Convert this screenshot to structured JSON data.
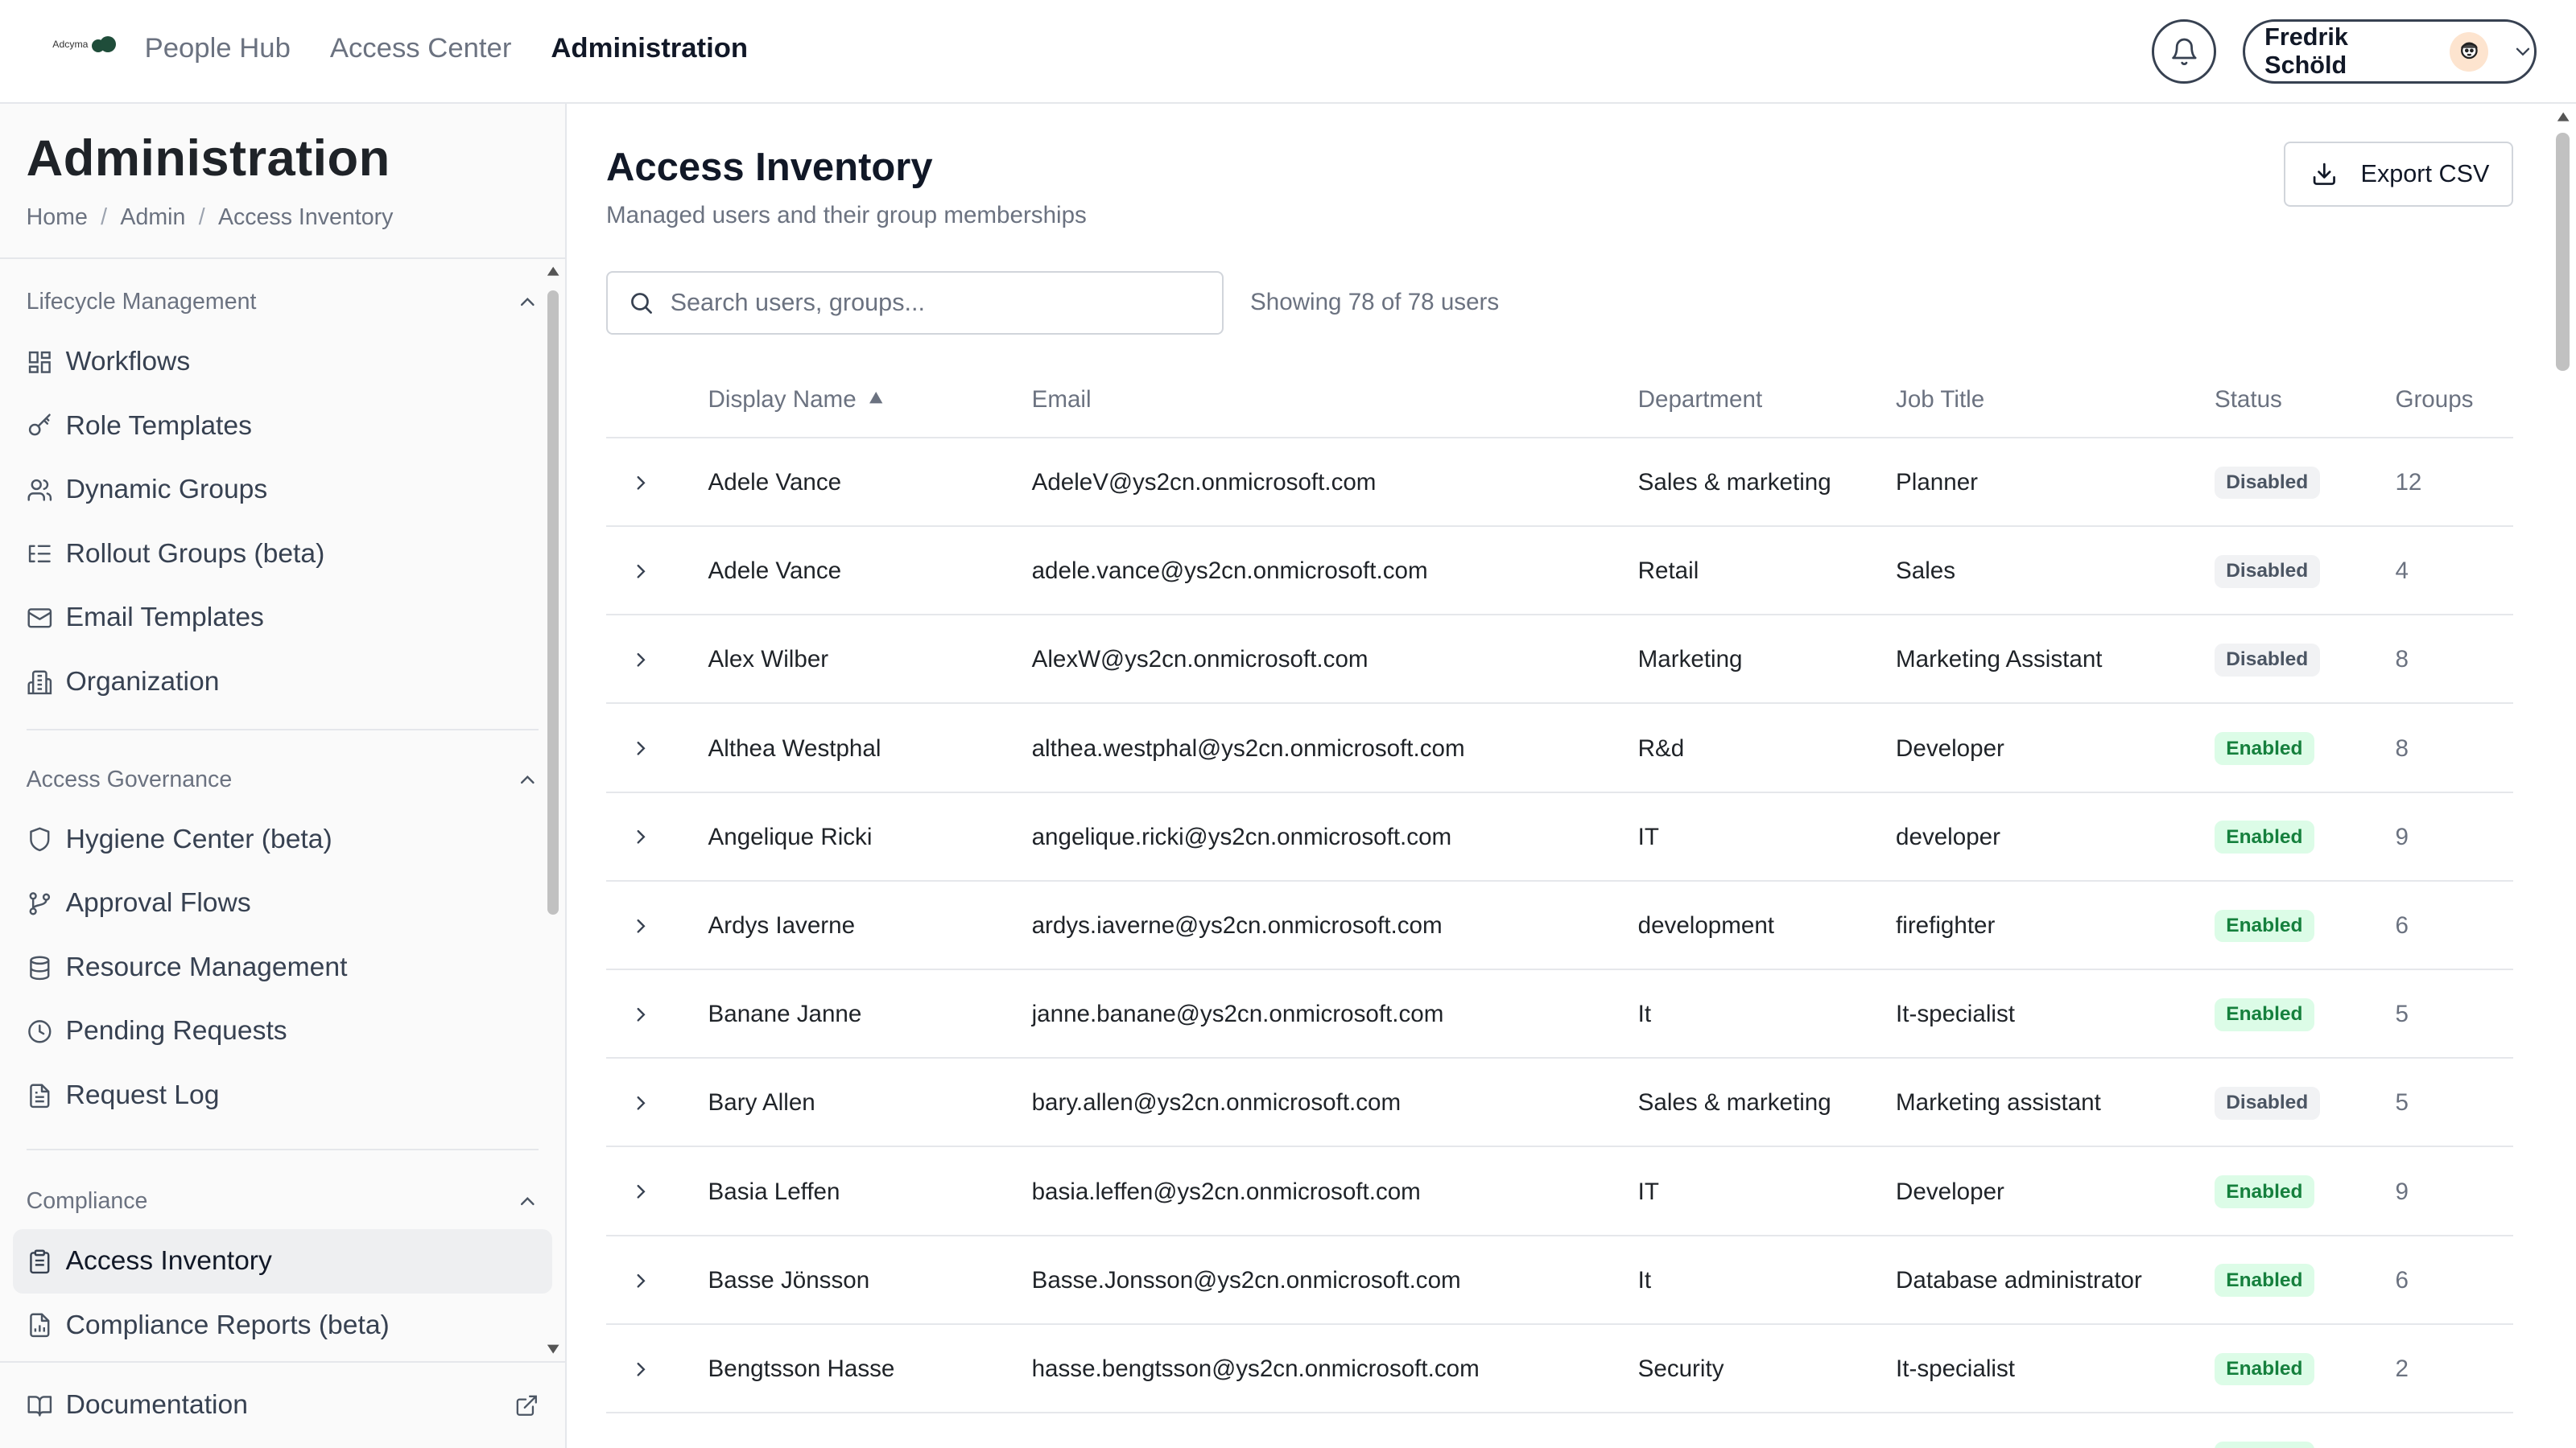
{
  "brand": {
    "logo_text": "Adcyma"
  },
  "topnav": [
    {
      "label": "People Hub",
      "active": false
    },
    {
      "label": "Access Center",
      "active": false
    },
    {
      "label": "Administration",
      "active": true
    }
  ],
  "user": {
    "name": "Fredrik Schöld"
  },
  "sidebar": {
    "title": "Administration",
    "breadcrumb": [
      "Home",
      "Admin",
      "Access Inventory"
    ],
    "sections": [
      {
        "title": "Lifecycle Management",
        "items": [
          {
            "label": "Workflows",
            "icon": "grid-icon"
          },
          {
            "label": "Role Templates",
            "icon": "key-icon"
          },
          {
            "label": "Dynamic Groups",
            "icon": "users-icon"
          },
          {
            "label": "Rollout Groups (beta)",
            "icon": "list-icon"
          },
          {
            "label": "Email Templates",
            "icon": "mail-icon"
          },
          {
            "label": "Organization",
            "icon": "building-icon"
          }
        ]
      },
      {
        "title": "Access Governance",
        "items": [
          {
            "label": "Hygiene Center (beta)",
            "icon": "shield-icon"
          },
          {
            "label": "Approval Flows",
            "icon": "git-branch-icon"
          },
          {
            "label": "Resource Management",
            "icon": "database-icon"
          },
          {
            "label": "Pending Requests",
            "icon": "clock-icon"
          },
          {
            "label": "Request Log",
            "icon": "file-text-icon"
          }
        ]
      },
      {
        "title": "Compliance",
        "items": [
          {
            "label": "Access Inventory",
            "icon": "clipboard-icon",
            "active": true
          },
          {
            "label": "Compliance Reports (beta)",
            "icon": "file-chart-icon"
          }
        ]
      }
    ],
    "footer": {
      "label": "Documentation",
      "icon": "book-icon"
    }
  },
  "main": {
    "title": "Access Inventory",
    "subtitle": "Managed users and their group memberships",
    "export_label": "Export CSV",
    "search_placeholder": "Search users, groups...",
    "showing": "Showing 78 of 78 users",
    "columns": {
      "name": "Display Name",
      "email": "Email",
      "department": "Department",
      "job_title": "Job Title",
      "status": "Status",
      "groups": "Groups"
    },
    "rows": [
      {
        "name": "Adele Vance",
        "email": "AdeleV@ys2cn.onmicrosoft.com",
        "department": "Sales & marketing",
        "job_title": "Planner",
        "status": "Disabled",
        "groups": "12"
      },
      {
        "name": "Adele Vance",
        "email": "adele.vance@ys2cn.onmicrosoft.com",
        "department": "Retail",
        "job_title": "Sales",
        "status": "Disabled",
        "groups": "4"
      },
      {
        "name": "Alex Wilber",
        "email": "AlexW@ys2cn.onmicrosoft.com",
        "department": "Marketing",
        "job_title": "Marketing Assistant",
        "status": "Disabled",
        "groups": "8"
      },
      {
        "name": "Althea Westphal",
        "email": "althea.westphal@ys2cn.onmicrosoft.com",
        "department": "R&d",
        "job_title": "Developer",
        "status": "Enabled",
        "groups": "8"
      },
      {
        "name": "Angelique Ricki",
        "email": "angelique.ricki@ys2cn.onmicrosoft.com",
        "department": "IT",
        "job_title": "developer",
        "status": "Enabled",
        "groups": "9"
      },
      {
        "name": "Ardys Iaverne",
        "email": "ardys.iaverne@ys2cn.onmicrosoft.com",
        "department": "development",
        "job_title": "firefighter",
        "status": "Enabled",
        "groups": "6"
      },
      {
        "name": "Banane Janne",
        "email": "janne.banane@ys2cn.onmicrosoft.com",
        "department": "It",
        "job_title": "It-specialist",
        "status": "Enabled",
        "groups": "5"
      },
      {
        "name": "Bary Allen",
        "email": "bary.allen@ys2cn.onmicrosoft.com",
        "department": "Sales & marketing",
        "job_title": "Marketing assistant",
        "status": "Disabled",
        "groups": "5"
      },
      {
        "name": "Basia Leffen",
        "email": "basia.leffen@ys2cn.onmicrosoft.com",
        "department": "IT",
        "job_title": "Developer",
        "status": "Enabled",
        "groups": "9"
      },
      {
        "name": "Basse Jönsson",
        "email": "Basse.Jonsson@ys2cn.onmicrosoft.com",
        "department": "It",
        "job_title": "Database administrator",
        "status": "Enabled",
        "groups": "6"
      },
      {
        "name": "Bengtsson Hasse",
        "email": "hasse.bengtsson@ys2cn.onmicrosoft.com",
        "department": "Security",
        "job_title": "It-specialist",
        "status": "Enabled",
        "groups": "2"
      },
      {
        "name": "",
        "email": "",
        "department": "",
        "job_title": "",
        "status": "Enabled",
        "groups": ""
      }
    ]
  },
  "colors": {
    "enabled": "#15803d",
    "enabled_bg": "#dcfce7",
    "disabled_bg": "#f1f2f4",
    "brand": "#1f4d3a"
  }
}
